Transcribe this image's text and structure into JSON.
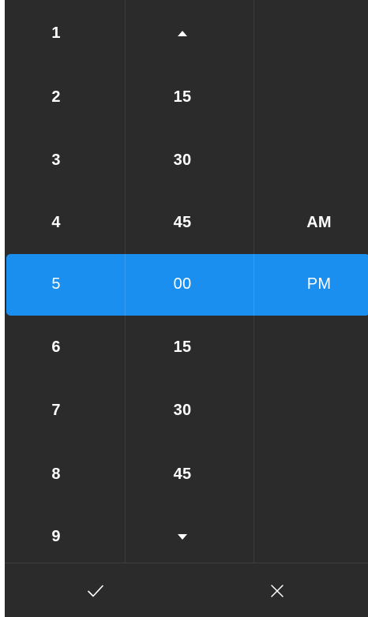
{
  "hours": [
    "1",
    "2",
    "3",
    "4",
    "5",
    "6",
    "7",
    "8",
    "9"
  ],
  "minutes": [
    "",
    "15",
    "30",
    "45",
    "00",
    "15",
    "30",
    "45",
    ""
  ],
  "periods": [
    "",
    "",
    "",
    "AM",
    "PM",
    "",
    "",
    "",
    ""
  ],
  "selected": {
    "hour": "5",
    "minute": "00",
    "period": "PM"
  },
  "colors": {
    "background": "#2b2b2b",
    "accent": "#1a8ff0",
    "text": "#ffffff",
    "divider": "#3d3d3d"
  },
  "icons": {
    "scroll_up": "triangle-up-icon",
    "scroll_down": "triangle-down-icon",
    "accept": "checkmark-icon",
    "dismiss": "close-icon"
  }
}
